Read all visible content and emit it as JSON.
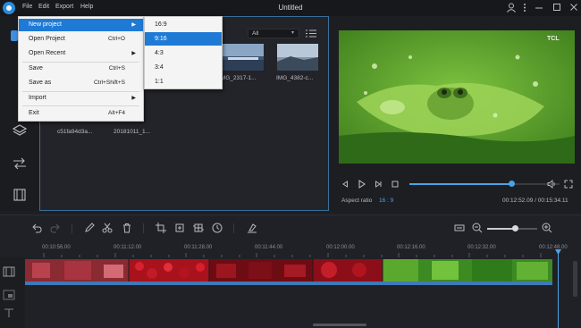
{
  "window": {
    "title": "Untitled"
  },
  "menubar": [
    {
      "label": "File",
      "active": true
    },
    {
      "label": "Edit"
    },
    {
      "label": "Export"
    },
    {
      "label": "Help"
    }
  ],
  "file_menu": [
    {
      "label": "New project",
      "shortcut": "",
      "submenu": true,
      "highlighted": true
    },
    {
      "label": "Open Project",
      "shortcut": "Ctrl+O"
    },
    {
      "label": "Open Recent",
      "shortcut": "",
      "submenu": true
    },
    {
      "label": "Save",
      "shortcut": "Ctrl+S"
    },
    {
      "label": "Save as",
      "shortcut": "Ctrl+Shift+S"
    },
    {
      "label": "Import",
      "shortcut": "",
      "submenu": true
    },
    {
      "label": "Exit",
      "shortcut": "Alt+F4"
    }
  ],
  "aspect_submenu": [
    {
      "label": "16:9"
    },
    {
      "label": "9:16",
      "highlighted": true
    },
    {
      "label": "4:3"
    },
    {
      "label": "3:4"
    },
    {
      "label": "1:1"
    }
  ],
  "media": {
    "filter_value": "All",
    "items": [
      {
        "label": "IMG_2317-1..."
      },
      {
        "label": "IMG_4382-c..."
      },
      {
        "label": "c51fa94d3a..."
      },
      {
        "label": "20181011_1..."
      }
    ]
  },
  "preview": {
    "badge": "TCL",
    "aspect_label": "Aspect ratio",
    "aspect_value": "16 : 9",
    "timecode": "00:12:52.09 / 00:15:34.11",
    "progress": 0.68
  },
  "timeline": {
    "ruler": [
      "00:10:56.00",
      "00:11:12.00",
      "00:11:28.00",
      "00:11:44.00",
      "00:12:00.00",
      "00:12:16.00",
      "00:12:32.00",
      "00:12:48.00"
    ],
    "zoom": 0.55
  },
  "colors": {
    "accent": "#1f7ad6",
    "timeline_accent": "#4aa3e8"
  }
}
